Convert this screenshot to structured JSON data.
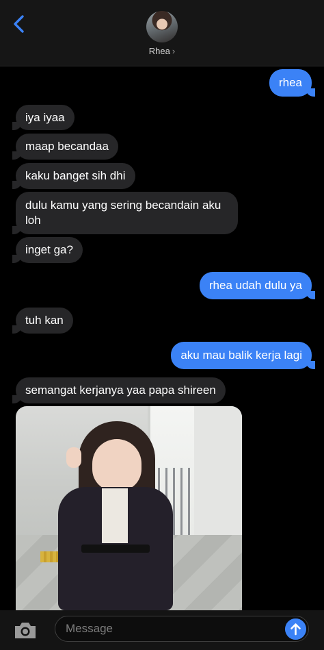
{
  "header": {
    "contact_name": "Rhea",
    "chevron": "›"
  },
  "messages": [
    {
      "dir": "out",
      "text": "rhea"
    },
    {
      "dir": "in",
      "text": "iya iyaa"
    },
    {
      "dir": "in",
      "text": "maap becandaa"
    },
    {
      "dir": "in",
      "text": "kaku banget sih dhi"
    },
    {
      "dir": "in",
      "text": "dulu kamu yang sering becandain aku loh"
    },
    {
      "dir": "in",
      "text": "inget ga?"
    },
    {
      "dir": "out",
      "text": "rhea udah dulu ya"
    },
    {
      "dir": "in",
      "text": "tuh kan"
    },
    {
      "dir": "out",
      "text": "aku mau balik kerja lagi"
    },
    {
      "dir": "in",
      "text": "semangat kerjanya yaa papa shireen"
    }
  ],
  "composer": {
    "placeholder": "Message"
  },
  "icons": {
    "back": "chevron-left-icon",
    "camera": "camera-icon",
    "send": "arrow-up-icon"
  },
  "colors": {
    "outgoing": "#3b82f6",
    "incoming": "#262628",
    "accent": "#3b82f6"
  }
}
